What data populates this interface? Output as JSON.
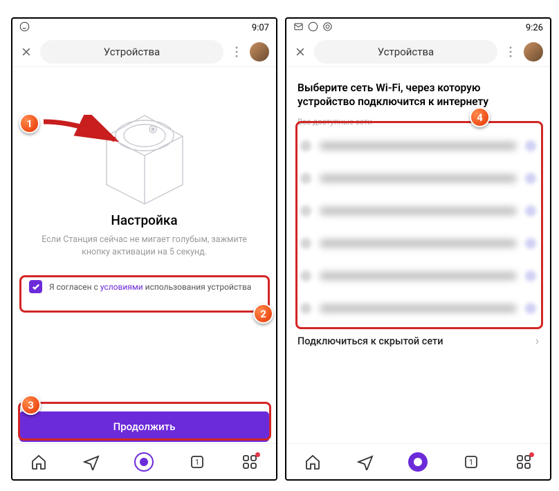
{
  "left": {
    "statusbar": {
      "time": "9:07"
    },
    "toolbar": {
      "title": "Устройства"
    },
    "setup": {
      "title": "Настройка",
      "description": "Если Станция сейчас не мигает голубым, зажмите кнопку активации на 5 секунд."
    },
    "terms": {
      "prefix": "Я согласен с ",
      "link": "условиями",
      "suffix": " использования устройства"
    },
    "continue_label": "Продолжить"
  },
  "right": {
    "statusbar": {
      "time": "9:26"
    },
    "toolbar": {
      "title": "Устройства"
    },
    "wifi": {
      "heading": "Выберите сеть Wi-Fi, через которую устройство подключится к интернету",
      "all_label": "Все доступные сети",
      "hidden_label": "Подключиться к скрытой сети"
    }
  },
  "callouts": {
    "c1": "1",
    "c2": "2",
    "c3": "3",
    "c4": "4"
  }
}
